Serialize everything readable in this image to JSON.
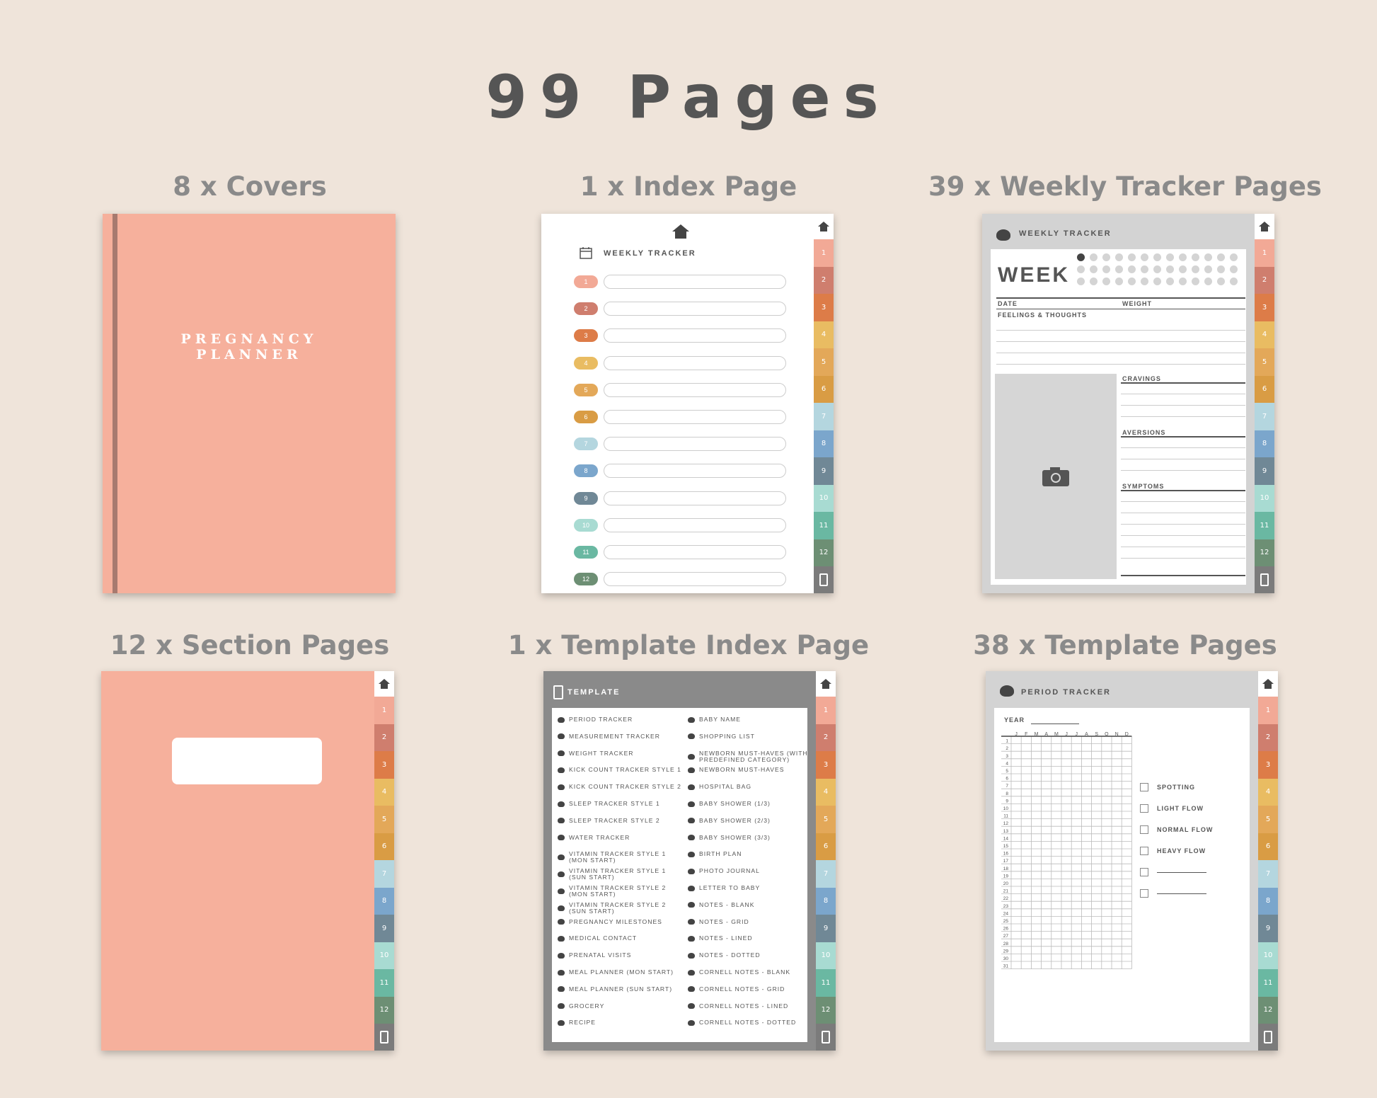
{
  "title": "99 Pages",
  "captions": {
    "covers": "8 x Covers",
    "index": "1 x Index Page",
    "weekly": "39 x Weekly Tracker Pages",
    "sections": "12 x Section Pages",
    "template_index": "1 x Template Index Page",
    "templates": "38 x Template Pages"
  },
  "cover": {
    "line1": "PREGNANCY",
    "line2": "PLANNER"
  },
  "tabs": {
    "labels": [
      "1",
      "2",
      "3",
      "4",
      "5",
      "6",
      "7",
      "8",
      "9",
      "10",
      "11",
      "12"
    ],
    "colors": [
      "#f2a996",
      "#cf7e6e",
      "#dd7c48",
      "#e9bc62",
      "#e3a859",
      "#d99c44",
      "#b4d6df",
      "#7ba6cc",
      "#708896",
      "#a8dbd2",
      "#6ab8a2",
      "#6d8f74"
    ]
  },
  "index_page": {
    "heading": "WEEKLY TRACKER",
    "numbers": [
      "1",
      "2",
      "3",
      "4",
      "5",
      "6",
      "7",
      "8",
      "9",
      "10",
      "11",
      "12"
    ]
  },
  "weekly_page": {
    "heading": "WEEKLY TRACKER",
    "week_label": "WEEK",
    "date": "DATE",
    "weight": "WEIGHT",
    "feelings": "FEELINGS & THOUGHTS",
    "cravings": "CRAVINGS",
    "aversions": "AVERSIONS",
    "symptoms": "SYMPTOMS"
  },
  "template_index_page": {
    "heading": "TEMPLATE",
    "left": [
      "PERIOD TRACKER",
      "MEASUREMENT TRACKER",
      "WEIGHT TRACKER",
      "KICK COUNT TRACKER STYLE 1",
      "KICK COUNT TRACKER STYLE 2",
      "SLEEP TRACKER STYLE 1",
      "SLEEP TRACKER STYLE 2",
      "WATER TRACKER",
      "VITAMIN TRACKER STYLE 1 (MON START)",
      "VITAMIN TRACKER STYLE 1 (SUN START)",
      "VITAMIN TRACKER STYLE 2 (MON START)",
      "VITAMIN TRACKER STYLE 2 (SUN START)",
      "PREGNANCY MILESTONES",
      "MEDICAL CONTACT",
      "PRENATAL VISITS",
      "MEAL PLANNER (MON START)",
      "MEAL PLANNER (SUN START)",
      "GROCERY",
      "RECIPE"
    ],
    "right": [
      "BABY NAME",
      "SHOPPING LIST",
      "NEWBORN MUST-HAVES (WITH PREDEFINED CATEGORY)",
      "NEWBORN MUST-HAVES",
      "HOSPITAL BAG",
      "BABY SHOWER (1/3)",
      "BABY SHOWER (2/3)",
      "BABY SHOWER (3/3)",
      "BIRTH PLAN",
      "PHOTO JOURNAL",
      "LETTER TO BABY",
      "NOTES - BLANK",
      "NOTES - GRID",
      "NOTES - LINED",
      "NOTES - DOTTED",
      "CORNELL NOTES - BLANK",
      "CORNELL NOTES - GRID",
      "CORNELL NOTES - LINED",
      "CORNELL NOTES - DOTTED"
    ]
  },
  "period_page": {
    "heading": "PERIOD TRACKER",
    "year": "YEAR",
    "months": [
      "J",
      "F",
      "M",
      "A",
      "M",
      "J",
      "J",
      "A",
      "S",
      "O",
      "N",
      "D"
    ],
    "days": [
      "1",
      "2",
      "3",
      "4",
      "5",
      "6",
      "7",
      "8",
      "9",
      "10",
      "11",
      "12",
      "13",
      "14",
      "15",
      "16",
      "17",
      "18",
      "19",
      "20",
      "21",
      "22",
      "23",
      "24",
      "25",
      "26",
      "27",
      "28",
      "29",
      "30",
      "31"
    ],
    "legend": [
      "SPOTTING",
      "LIGHT FLOW",
      "NORMAL FLOW",
      "HEAVY FLOW"
    ]
  }
}
